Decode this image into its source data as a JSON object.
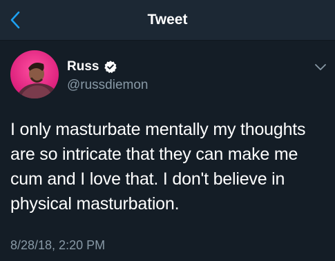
{
  "header": {
    "title": "Tweet",
    "back_icon": "chevron-left-icon",
    "accent_color": "#1da1f2"
  },
  "tweet": {
    "author": {
      "display_name": "Russ",
      "handle": "@russdiemon",
      "verified": true,
      "verified_icon": "verified-badge-icon"
    },
    "menu_icon": "chevron-down-icon",
    "text": "I only masturbate mentally my thoughts are so intricate that they can make me cum and I love that. I don't believe in physical masturbation.",
    "timestamp": "8/28/18, 2:20 PM"
  },
  "colors": {
    "background": "#141d26",
    "header_background": "#1c2834",
    "secondary_text": "#8899a6"
  }
}
